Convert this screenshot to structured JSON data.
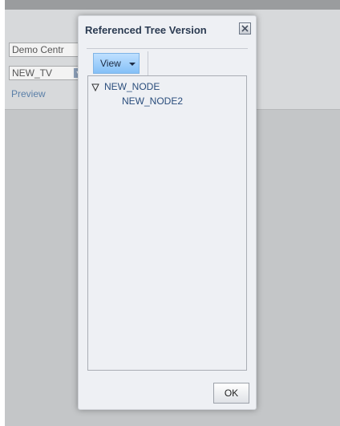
{
  "background": {
    "tree_field_value": "Demo Centr",
    "version_select_value": "NEW_TV",
    "preview_link": "Preview"
  },
  "dialog": {
    "title": "Referenced Tree Version",
    "close_icon": "close-icon",
    "toolbar": {
      "view_button": "View"
    },
    "tree": {
      "nodes": [
        {
          "label": "NEW_NODE",
          "expanded": true
        },
        {
          "label": "NEW_NODE2",
          "expanded": false
        }
      ]
    },
    "ok_button": "OK"
  },
  "colors": {
    "accent": "#84c0f7",
    "tree_text": "#2a4d7c",
    "title_text": "#2b3b52"
  }
}
